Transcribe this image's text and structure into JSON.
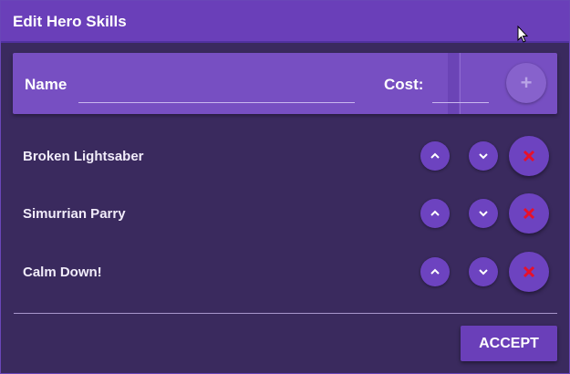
{
  "dialog": {
    "title": "Edit Hero Skills"
  },
  "add_form": {
    "name_label": "Name",
    "name_value": "",
    "cost_label": "Cost:",
    "cost_value": "",
    "add_icon": "plus-icon"
  },
  "skills": [
    {
      "name": "Broken Lightsaber"
    },
    {
      "name": "Simurrian Parry"
    },
    {
      "name": "Calm Down!"
    }
  ],
  "row_icons": {
    "up": "chevron-up-icon",
    "down": "chevron-down-icon",
    "delete": "close-icon"
  },
  "footer": {
    "accept_label": "ACCEPT"
  },
  "colors": {
    "accent": "#6a3fb9",
    "background": "#3a2a5e",
    "delete_icon": "#e8102a"
  }
}
